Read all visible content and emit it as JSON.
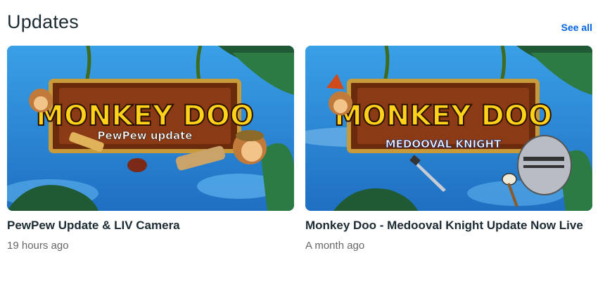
{
  "section": {
    "title": "Updates",
    "see_all_label": "See all"
  },
  "cards": [
    {
      "title": "PewPew Update & LIV Camera",
      "time": "19 hours ago",
      "sign_title": "MONKEY DOO",
      "sign_subtitle": "PewPew update"
    },
    {
      "title": "Monkey Doo - Medooval Knight Update Now Live",
      "time": "A month ago",
      "sign_title": "MONKEY DOO",
      "sign_subtitle": "MEDOOVAL KNIGHT"
    }
  ],
  "colors": {
    "accent": "#0064e0",
    "sky": "#2d8fd8",
    "sign_text": "#ffd21a",
    "sign_wood": "#8a3a14"
  }
}
